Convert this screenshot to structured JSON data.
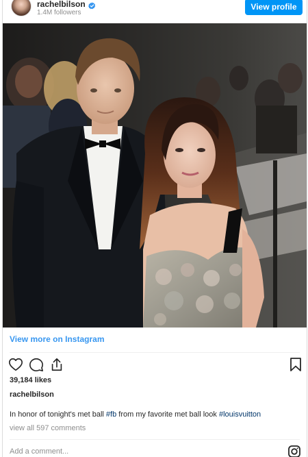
{
  "header": {
    "username": "rachelbilson",
    "followers": "1.4M followers",
    "view_profile_label": "View profile"
  },
  "post": {
    "view_more_label": "View more on Instagram",
    "likes": "39,184 likes",
    "caption_user": "rachelbilson",
    "caption": {
      "text_before": "In honor of tonight's met ball ",
      "hashtag_1": "#fb",
      "text_middle": " from my favorite met ball look ",
      "hashtag_2": "#louisvuitton"
    },
    "comments_link": "view all 597 comments",
    "comment_placeholder": "Add a comment..."
  },
  "icons": {
    "avatar": "profile-avatar",
    "verified": "verified-badge-icon",
    "like": "heart-icon",
    "comment": "comment-icon",
    "share": "share-icon",
    "save": "bookmark-icon",
    "instagram": "instagram-glyph-icon"
  },
  "colors": {
    "accent": "#0095f6",
    "link": "#3897f0",
    "hashtag": "#003569",
    "muted": "#8e8e8e"
  }
}
